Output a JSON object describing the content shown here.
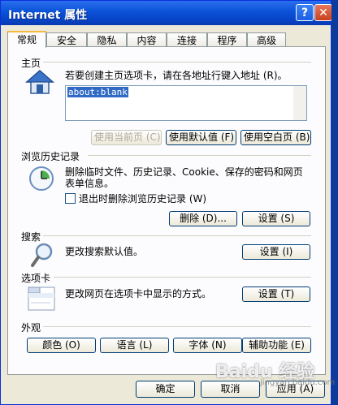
{
  "window": {
    "title": "Internet 属性",
    "help_label": "?",
    "close_label": "✕"
  },
  "tabs": [
    {
      "label": "常规",
      "active": true
    },
    {
      "label": "安全"
    },
    {
      "label": "隐私"
    },
    {
      "label": "内容"
    },
    {
      "label": "连接"
    },
    {
      "label": "程序"
    },
    {
      "label": "高级"
    }
  ],
  "home": {
    "title": "主页",
    "description": "若要创建主页选项卡，请在各地址行键入地址 (R)。",
    "url_value": "about:blank",
    "buttons": {
      "use_current": "使用当前页 (C)",
      "use_default": "使用默认值 (F)",
      "use_blank": "使用空白页 (B)"
    }
  },
  "history": {
    "title": "浏览历史记录",
    "description_line1": "删除临时文件、历史记录、Cookie、保存的密码和网页",
    "description_line2": "表单信息。",
    "checkbox_label": "退出时删除浏览历史记录 (W)",
    "checkbox_checked": false,
    "delete_button": "删除 (D)...",
    "settings_button": "设置 (S)"
  },
  "search": {
    "title": "搜索",
    "description": "更改搜索默认值。",
    "settings_button": "设置 (I)"
  },
  "tabs_section": {
    "title": "选项卡",
    "description": "更改网页在选项卡中显示的方式。",
    "settings_button": "设置 (T)"
  },
  "appearance": {
    "title": "外观",
    "buttons": {
      "colors": "颜色 (O)",
      "languages": "语言 (L)",
      "fonts": "字体 (N)",
      "accessibility": "辅助功能 (E)"
    }
  },
  "footer": {
    "ok": "确定",
    "cancel": "取消",
    "apply": "应用 (A)"
  },
  "watermark": {
    "text": "Baidu 经验",
    "sub": "jingyan.baidu.com"
  }
}
